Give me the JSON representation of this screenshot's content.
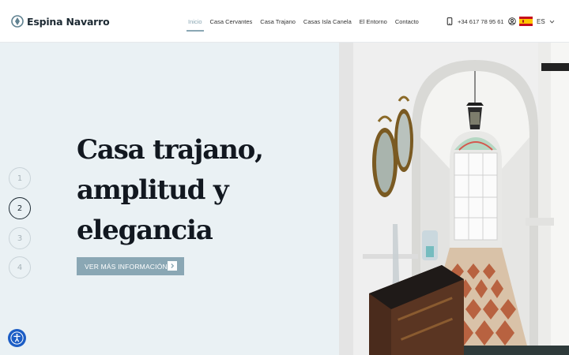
{
  "brand": {
    "name": "Espina Navarro"
  },
  "nav": {
    "items": [
      {
        "label": "Inicio",
        "active": true
      },
      {
        "label": "Casa Cervantes",
        "active": false
      },
      {
        "label": "Casa Trajano",
        "active": false
      },
      {
        "label": "Casas Isla Canela",
        "active": false
      },
      {
        "label": "El Entorno",
        "active": false
      },
      {
        "label": "Contacto",
        "active": false
      }
    ]
  },
  "contact": {
    "phone": "+34 617 78 95 61",
    "phone_icon": "phone-icon",
    "account_icon": "user-icon"
  },
  "language": {
    "code": "ES",
    "flag": "spain-flag-icon"
  },
  "hero": {
    "headline_lines": [
      "Casa trajano,",
      "amplitud y",
      "elegancia"
    ],
    "cta_label": "VER MÁS INFORMACIÓN",
    "slides": [
      "1",
      "2",
      "3",
      "4"
    ],
    "active_slide": 2,
    "image_alt": "Hallway with arched doorway, mirrors and antique dresser"
  },
  "colors": {
    "accent": "#8aa7b4",
    "hero_bg": "#eaf1f4",
    "text_dark": "#121820",
    "accessibility_blue": "#1c5dc5"
  },
  "accessibility": {
    "icon": "accessibility-icon"
  }
}
